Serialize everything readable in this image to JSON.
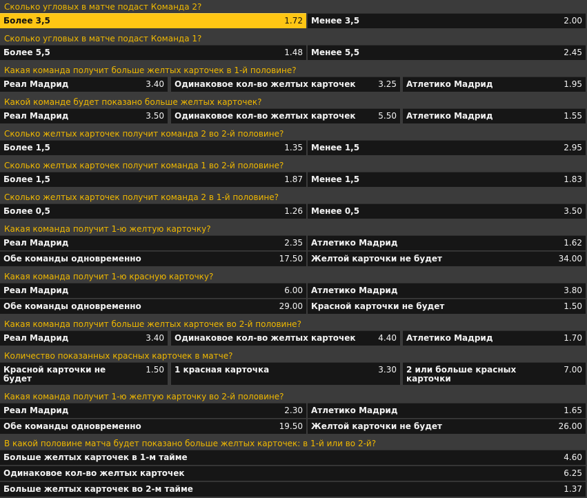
{
  "markets": [
    {
      "question": "Сколько угловых в матче подаст Команда 2?",
      "rows": [
        [
          {
            "label": "Более 3,5",
            "odd": "1.72",
            "selected": true
          },
          {
            "label": "Менее 3,5",
            "odd": "2.00"
          }
        ]
      ]
    },
    {
      "question": "Сколько угловых в матче подаст Команда 1?",
      "rows": [
        [
          {
            "label": "Более 5,5",
            "odd": "1.48"
          },
          {
            "label": "Менее 5,5",
            "odd": "2.45"
          }
        ]
      ]
    },
    {
      "question": "Какая команда получит больше желтых карточек в 1-й половине?",
      "rows": [
        [
          {
            "label": "Реал Мадрид",
            "odd": "3.40"
          },
          {
            "label": "Одинаковое кол-во желтых карточек",
            "odd": "3.25"
          },
          {
            "label": "Атлетико Мадрид",
            "odd": "1.95"
          }
        ]
      ]
    },
    {
      "question": "Какой команде будет показано больше желтых карточек?",
      "rows": [
        [
          {
            "label": "Реал Мадрид",
            "odd": "3.50"
          },
          {
            "label": "Одинаковое кол-во желтых карточек",
            "odd": "5.50"
          },
          {
            "label": "Атлетико Мадрид",
            "odd": "1.55"
          }
        ]
      ]
    },
    {
      "question": "Сколько желтых карточек получит команда 2 во 2-й половине?",
      "rows": [
        [
          {
            "label": "Более 1,5",
            "odd": "1.35"
          },
          {
            "label": "Менее 1,5",
            "odd": "2.95"
          }
        ]
      ]
    },
    {
      "question": "Сколько желтых карточек получит команда 1 во 2-й половине?",
      "rows": [
        [
          {
            "label": "Более 1,5",
            "odd": "1.87"
          },
          {
            "label": "Менее 1,5",
            "odd": "1.83"
          }
        ]
      ]
    },
    {
      "question": "Сколько желтых карточек получит команда 2 в 1-й половине?",
      "rows": [
        [
          {
            "label": "Более 0,5",
            "odd": "1.26"
          },
          {
            "label": "Менее 0,5",
            "odd": "3.50"
          }
        ]
      ]
    },
    {
      "question": "Какая команда получит 1-ю желтую карточку?",
      "rows": [
        [
          {
            "label": "Реал Мадрид",
            "odd": "2.35"
          },
          {
            "label": "Атлетико Мадрид",
            "odd": "1.62"
          }
        ],
        [
          {
            "label": "Обе команды одновременно",
            "odd": "17.50"
          },
          {
            "label": "Желтой карточки не будет",
            "odd": "34.00"
          }
        ]
      ]
    },
    {
      "question": "Какая команда получит 1-ю красную карточку?",
      "rows": [
        [
          {
            "label": "Реал Мадрид",
            "odd": "6.00"
          },
          {
            "label": "Атлетико Мадрид",
            "odd": "3.80"
          }
        ],
        [
          {
            "label": "Обе команды одновременно",
            "odd": "29.00"
          },
          {
            "label": "Красной карточки не будет",
            "odd": "1.50"
          }
        ]
      ]
    },
    {
      "question": "Какая команда получит больше желтых карточек во 2-й половине?",
      "rows": [
        [
          {
            "label": "Реал Мадрид",
            "odd": "3.40"
          },
          {
            "label": "Одинаковое кол-во желтых карточек",
            "odd": "4.40"
          },
          {
            "label": "Атлетико Мадрид",
            "odd": "1.70"
          }
        ]
      ]
    },
    {
      "question": "Количество показанных красных карточек в матче?",
      "rows": [
        [
          {
            "label": "Красной карточки не будет",
            "odd": "1.50"
          },
          {
            "label": "1 красная карточка",
            "odd": "3.30"
          },
          {
            "label": "2 или больше красных карточки",
            "odd": "7.00"
          }
        ]
      ]
    },
    {
      "question": "Какая команда получит 1-ю желтую карточку во 2-й половине?",
      "rows": [
        [
          {
            "label": "Реал Мадрид",
            "odd": "2.30"
          },
          {
            "label": "Атлетико Мадрид",
            "odd": "1.65"
          }
        ],
        [
          {
            "label": "Обе команды одновременно",
            "odd": "19.50"
          },
          {
            "label": "Желтой карточки не будет",
            "odd": "26.00"
          }
        ]
      ]
    },
    {
      "question": "В какой половине матча будет показано больше желтых карточек: в 1-й или во 2-й?",
      "rows": [
        [
          {
            "label": "Больше желтых карточек в 1-м тайме",
            "odd": "4.60"
          }
        ],
        [
          {
            "label": "Одинаковое кол-во желтых карточек",
            "odd": "6.25"
          }
        ],
        [
          {
            "label": "Больше желтых карточек во 2-м тайме",
            "odd": "1.37"
          }
        ]
      ]
    }
  ]
}
